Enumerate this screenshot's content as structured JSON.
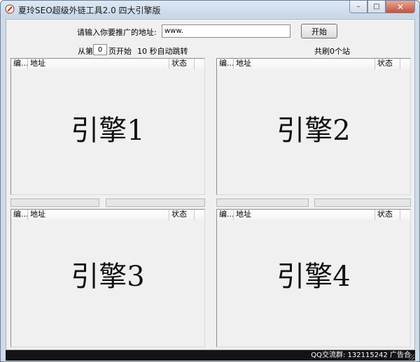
{
  "window": {
    "title": "夏玲SEO超级外链工具2.0 四大引擎版",
    "minimize_glyph": "–",
    "maximize_glyph": "□",
    "close_glyph": "✕",
    "app_icon": "app-icon"
  },
  "form": {
    "url_label": "请输入你要推广的地址:",
    "url_value": "www.",
    "start_button": "开始"
  },
  "controls": {
    "from_page_prefix": "从第",
    "page_number": "0",
    "page_start_suffix": "页开始",
    "auto_jump": "10 秒自动跳转",
    "site_count": "共刷0个站"
  },
  "columns": {
    "num": "编...",
    "address": "地址",
    "status": "状态"
  },
  "engines": [
    {
      "label": "引擎1"
    },
    {
      "label": "引擎2"
    },
    {
      "label": "引擎3"
    },
    {
      "label": "引擎4"
    }
  ],
  "status_bar": {
    "text": "QQ交流群: 132115242 广告合"
  },
  "colors": {
    "close_button": "#c8503b",
    "status_bar_bg": "#141414",
    "window_frame": "#cfdbe8"
  }
}
